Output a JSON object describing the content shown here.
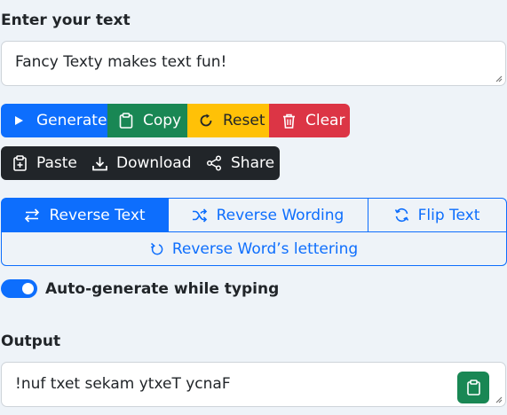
{
  "input": {
    "label": "Enter your text",
    "value": "Fancy Texty makes text fun!"
  },
  "actions_row1": [
    {
      "label": "Generate",
      "icon": "play-icon",
      "color": "#0d6efd"
    },
    {
      "label": "Copy",
      "icon": "clipboard-icon",
      "color": "#198754"
    },
    {
      "label": "Reset",
      "icon": "refresh-icon",
      "color": "#ffc107"
    },
    {
      "label": "Clear",
      "icon": "trash-icon",
      "color": "#dc3545"
    }
  ],
  "actions_row2": [
    {
      "label": "Paste",
      "icon": "clipboard-plus-icon",
      "color": "#212529"
    },
    {
      "label": "Download",
      "icon": "download-icon",
      "color": "#212529"
    },
    {
      "label": "Share",
      "icon": "share-icon",
      "color": "#212529"
    }
  ],
  "modes": [
    {
      "label": "Reverse Text",
      "icon": "arrows-left-right-icon",
      "active": true
    },
    {
      "label": "Reverse Wording",
      "icon": "shuffle-icon",
      "active": false
    },
    {
      "label": "Flip Text",
      "icon": "sync-icon",
      "active": false
    },
    {
      "label": "Reverse Word’s lettering",
      "icon": "rotate-icon",
      "active": false
    }
  ],
  "auto_generate": {
    "label": "Auto-generate while typing",
    "enabled": true
  },
  "output": {
    "label": "Output",
    "value": "!nuf txet sekam ytxeT ycnaF"
  },
  "colors": {
    "primary": "#0d6efd",
    "background": "#eef3f8"
  }
}
